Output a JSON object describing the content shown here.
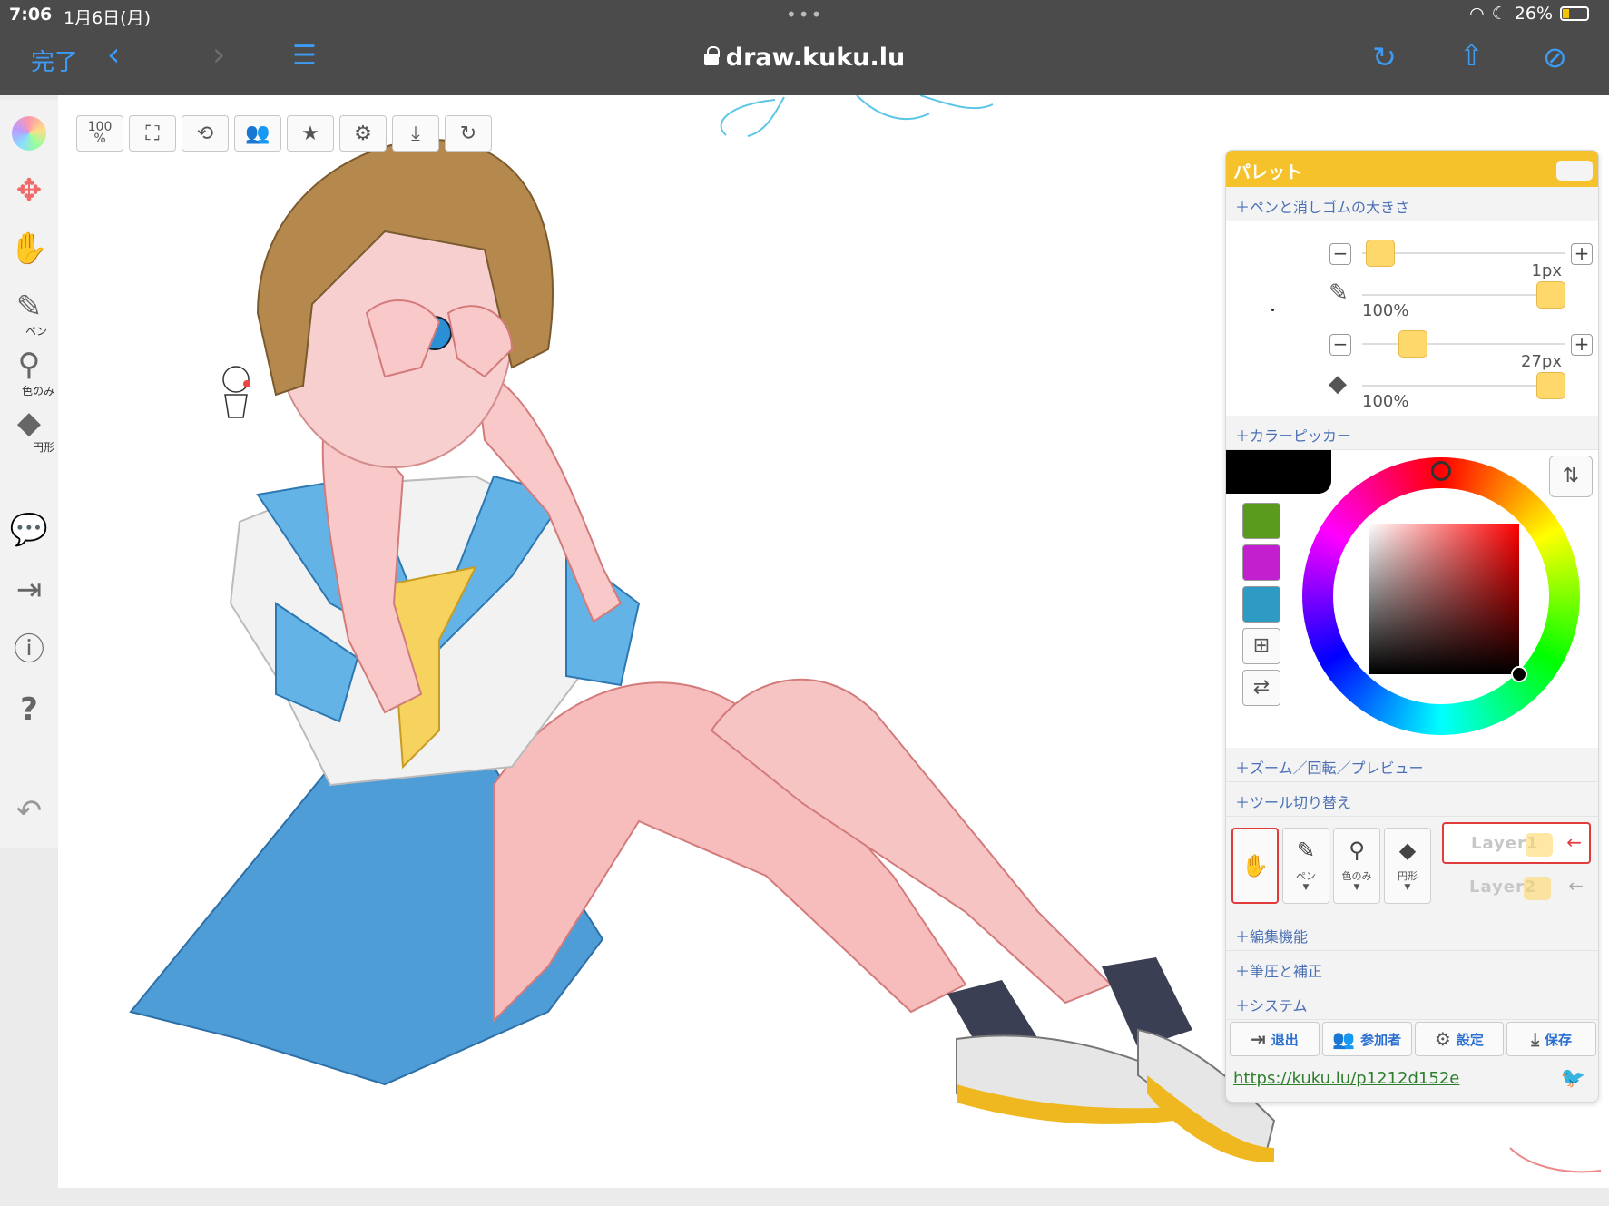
{
  "status": {
    "time": "7:06",
    "date": "1月6日(月)",
    "battery": "26%"
  },
  "browser": {
    "done_label": "完了",
    "url": "draw.kuku.lu"
  },
  "left_tools": [
    {
      "name": "color-wheel-icon",
      "label": ""
    },
    {
      "name": "move-icon",
      "label": ""
    },
    {
      "name": "hand-icon",
      "label": ""
    },
    {
      "name": "pen-icon",
      "label": "ペン"
    },
    {
      "name": "eyedropper-icon",
      "label": "色のみ"
    },
    {
      "name": "eraser-icon",
      "label": "円形"
    },
    {
      "name": "chat-icon",
      "label": ""
    },
    {
      "name": "exit-icon",
      "label": ""
    },
    {
      "name": "info-icon",
      "label": ""
    },
    {
      "name": "help-icon",
      "label": ""
    },
    {
      "name": "undo-icon",
      "label": ""
    }
  ],
  "top_tools": {
    "zoom_top": "100",
    "zoom_bottom": "%"
  },
  "palette": {
    "title": "パレット",
    "sections": {
      "size": "＋ペンと消しゴムの大きさ",
      "picker": "＋カラーピッカー",
      "zoom": "＋ズーム／回転／プレビュー",
      "switch": "＋ツール切り替え",
      "edit": "＋編集機能",
      "pressure": "＋筆圧と補正",
      "system": "＋システム"
    },
    "pen_size": "1px",
    "pen_opacity": "100%",
    "eraser_size": "27px",
    "eraser_opacity": "100%",
    "swatches": [
      "#5a9a1c",
      "#c21fcf",
      "#2d9bc4"
    ],
    "current_color": "#000000",
    "tool_switch": [
      {
        "name": "hand",
        "label": ""
      },
      {
        "name": "pen",
        "label": "ペン"
      },
      {
        "name": "eyedropper",
        "label": "色のみ"
      },
      {
        "name": "eraser",
        "label": "円形"
      }
    ],
    "layers": [
      "Layer1",
      "Layer2"
    ],
    "bottom_buttons": {
      "exit": "退出",
      "members": "参加者",
      "settings": "設定",
      "save": "保存"
    },
    "share_url": "https://kuku.lu/p1212d152e"
  }
}
